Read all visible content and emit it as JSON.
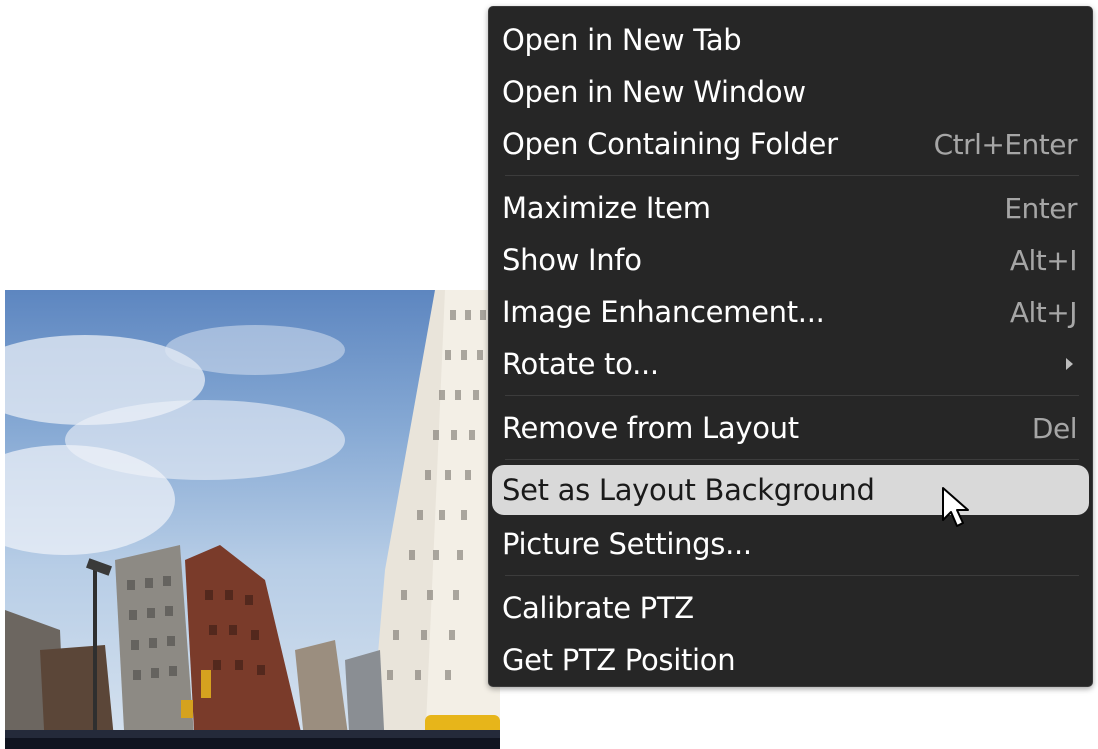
{
  "context_menu": {
    "items": [
      {
        "label": "Open in New Tab",
        "shortcut": ""
      },
      {
        "label": "Open in New Window",
        "shortcut": ""
      },
      {
        "label": "Open Containing Folder",
        "shortcut": "Ctrl+Enter"
      },
      {
        "label": "Maximize Item",
        "shortcut": "Enter"
      },
      {
        "label": "Show Info",
        "shortcut": "Alt+I"
      },
      {
        "label": "Image Enhancement...",
        "shortcut": "Alt+J"
      },
      {
        "label": "Rotate to...",
        "shortcut": "",
        "submenu": true
      },
      {
        "label": "Remove from Layout",
        "shortcut": "Del"
      },
      {
        "label": "Set as Layout Background",
        "shortcut": "",
        "highlighted": true
      },
      {
        "label": "Picture Settings...",
        "shortcut": ""
      },
      {
        "label": "Calibrate PTZ",
        "shortcut": ""
      },
      {
        "label": "Get PTZ Position",
        "shortcut": ""
      }
    ]
  },
  "colors": {
    "menu_background": "#262626",
    "highlight": "#d9d9d9",
    "shortcut_text": "#a6a6a6"
  },
  "icons": {
    "submenu": "chevron-right-icon",
    "cursor": "mouse-pointer-icon"
  }
}
